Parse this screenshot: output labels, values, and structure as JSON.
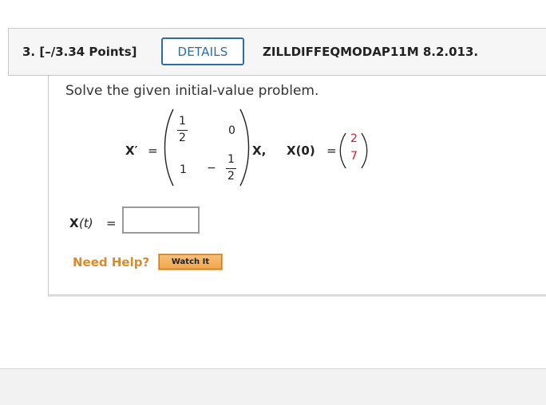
{
  "question": {
    "number_points": "3. [–/3.34 Points]",
    "details_label": "DETAILS",
    "code": "ZILLDIFFEQMODAP11M 8.2.013."
  },
  "problem": {
    "prompt": "Solve the given initial-value problem.",
    "lhs": "X′",
    "equals": "=",
    "matrix": {
      "a11_num": "1",
      "a11_den": "2",
      "a12": "0",
      "a21": "1",
      "a22_sign": "−",
      "a22_num": "1",
      "a22_den": "2"
    },
    "rhs_var": "X,",
    "ic_lhs": "X(0)",
    "ic_equals": "=",
    "ic_vector": [
      "2",
      "7"
    ]
  },
  "answer": {
    "label_var": "X",
    "label_arg": "(t)",
    "equals": "=",
    "value": "",
    "placeholder": ""
  },
  "help": {
    "need_help": "Need Help?",
    "watch_it": "Watch It"
  },
  "colors": {
    "accent_blue": "#2e6da4",
    "help_orange": "#d98b2b",
    "ic_red": "#d02020"
  }
}
